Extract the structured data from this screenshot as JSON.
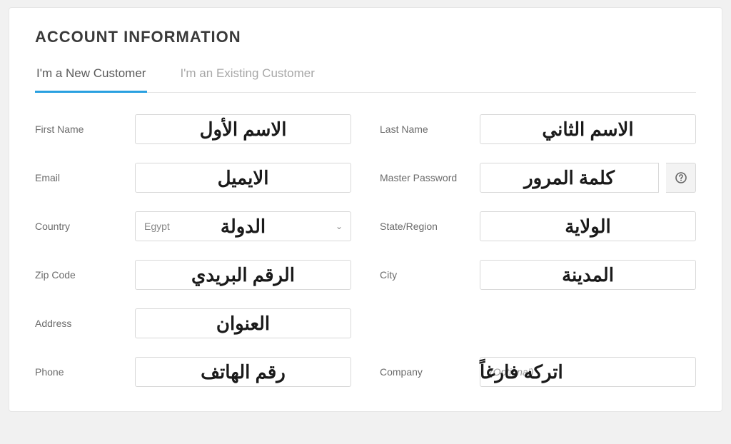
{
  "title": "ACCOUNT INFORMATION",
  "tabs": {
    "new": "I'm a New Customer",
    "existing": "I'm an Existing Customer"
  },
  "labels": {
    "first_name": "First Name",
    "last_name": "Last Name",
    "email": "Email",
    "master_password": "Master Password",
    "country": "Country",
    "state_region": "State/Region",
    "zip_code": "Zip Code",
    "city": "City",
    "address": "Address",
    "phone": "Phone",
    "company": "Company"
  },
  "values": {
    "country_selected": "Egypt",
    "company_placeholder": "(Optional)"
  },
  "annotations": {
    "first_name": "الاسم الأول",
    "last_name": "الاسم الثاني",
    "email": "الايميل",
    "master_password": "كلمة المرور",
    "country": "الدولة",
    "state_region": "الولاية",
    "zip_code": "الرقم البريدي",
    "city": "المدينة",
    "address": "العنوان",
    "phone": "رقم الهاتف",
    "company": "اتركه فارغاً"
  }
}
